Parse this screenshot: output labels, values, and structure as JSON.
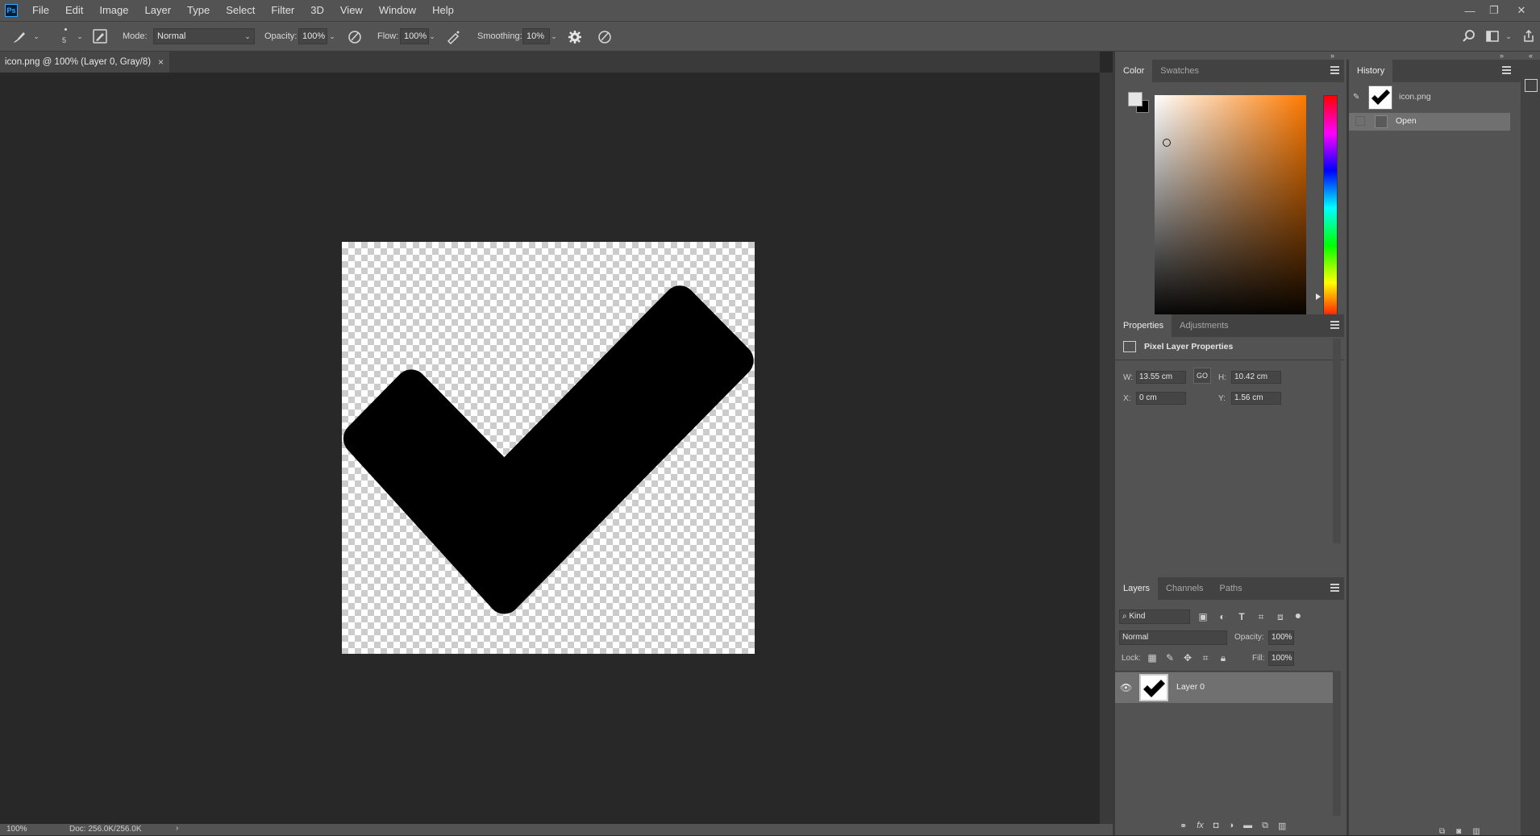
{
  "app": {
    "logo": "Ps"
  },
  "menu": [
    "File",
    "Edit",
    "Image",
    "Layer",
    "Type",
    "Select",
    "Filter",
    "3D",
    "View",
    "Window",
    "Help"
  ],
  "window_controls": {
    "minimize": "—",
    "restore": "❐",
    "close": "✕"
  },
  "options_bar": {
    "brush_size": "5",
    "mode_label": "Mode:",
    "mode_value": "Normal",
    "opacity_label": "Opacity:",
    "opacity_value": "100%",
    "flow_label": "Flow:",
    "flow_value": "100%",
    "smoothing_label": "Smoothing:",
    "smoothing_value": "10%"
  },
  "document_tab": {
    "title": "icon.png @ 100% (Layer 0, Gray/8)",
    "close": "×"
  },
  "status_bar": {
    "zoom": "100%",
    "doc_size": "Doc: 256.0K/256.0K",
    "arrow": "›"
  },
  "color_panel": {
    "tabs": [
      "Color",
      "Swatches"
    ],
    "foreground": "#e6e6e6",
    "background": "#000000",
    "field_hue": "#ff7a00"
  },
  "history_panel": {
    "tabs": [
      "History"
    ],
    "snapshot_label": "icon.png",
    "states": [
      {
        "label": "Open"
      }
    ]
  },
  "properties_panel": {
    "tabs": [
      "Properties",
      "Adjustments"
    ],
    "heading": "Pixel Layer Properties",
    "w_label": "W:",
    "w_value": "13.55 cm",
    "link_label": "GO",
    "h_label": "H:",
    "h_value": "10.42 cm",
    "x_label": "X:",
    "x_value": "0 cm",
    "y_label": "Y:",
    "y_value": "1.56 cm"
  },
  "layers_panel": {
    "tabs": [
      "Layers",
      "Channels",
      "Paths"
    ],
    "filter_kind": "Kind",
    "blend_mode": "Normal",
    "opacity_label": "Opacity:",
    "opacity_value": "100%",
    "lock_label": "Lock:",
    "fill_label": "Fill:",
    "fill_value": "100%",
    "layers": [
      {
        "name": "Layer 0",
        "visible": true
      }
    ]
  }
}
